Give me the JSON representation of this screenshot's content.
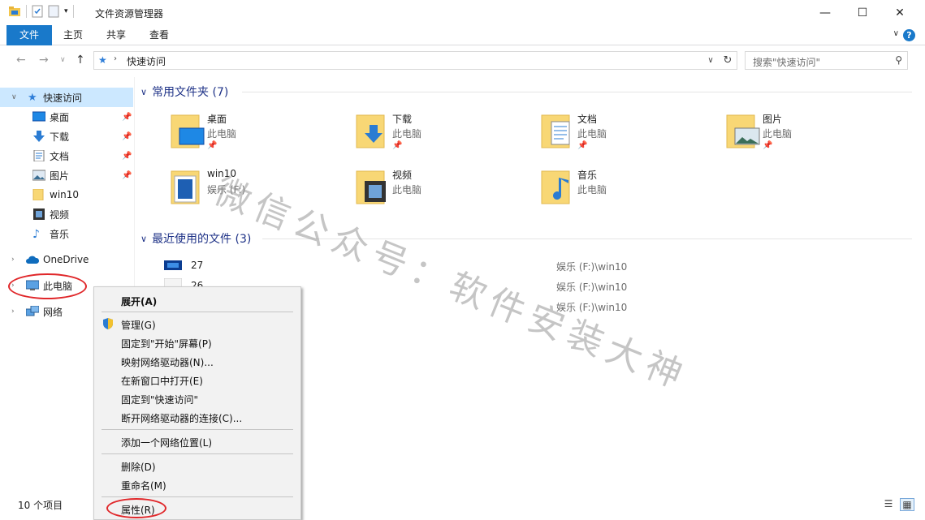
{
  "window": {
    "title": "文件资源管理器",
    "min_glyph": "—",
    "max_glyph": "☐",
    "close_glyph": "✕"
  },
  "ribbon": {
    "tabs": [
      "文件",
      "主页",
      "共享",
      "查看"
    ],
    "help": "?"
  },
  "address": {
    "path": "快速访问",
    "search_placeholder": "搜索\"快速访问\""
  },
  "nav": {
    "quick_access": "快速访问",
    "items": [
      "桌面",
      "下载",
      "文档",
      "图片",
      "win10",
      "视频",
      "音乐"
    ],
    "onedrive": "OneDrive",
    "this_pc": "此电脑",
    "network": "网络"
  },
  "groups": {
    "frequent": "常用文件夹 (7)",
    "recent": "最近使用的文件 (3)"
  },
  "folders": [
    {
      "name": "桌面",
      "location": "此电脑",
      "pinned": true
    },
    {
      "name": "下载",
      "location": "此电脑",
      "pinned": true
    },
    {
      "name": "文档",
      "location": "此电脑",
      "pinned": true
    },
    {
      "name": "图片",
      "location": "此电脑",
      "pinned": true
    },
    {
      "name": "win10",
      "location": "娱乐 (F:)",
      "pinned": false
    },
    {
      "name": "视频",
      "location": "此电脑",
      "pinned": false
    },
    {
      "name": "音乐",
      "location": "此电脑",
      "pinned": false
    }
  ],
  "recent_files": [
    {
      "name": "27",
      "path": "娱乐 (F:)\\win10"
    },
    {
      "name": "26",
      "path": "娱乐 (F:)\\win10"
    },
    {
      "name": "",
      "path": "娱乐 (F:)\\win10"
    }
  ],
  "status": {
    "count": "10 个项目"
  },
  "context_menu": {
    "items": [
      "展开(A)",
      "管理(G)",
      "固定到\"开始\"屏幕(P)",
      "映射网络驱动器(N)...",
      "在新窗口中打开(E)",
      "固定到\"快速访问\"",
      "断开网络驱动器的连接(C)...",
      "添加一个网络位置(L)",
      "删除(D)",
      "重命名(M)",
      "属性(R)"
    ]
  },
  "watermark": "微信公众号：软件安装大神",
  "colors": {
    "accent": "#1979ca",
    "selection": "#cce8ff",
    "annotation": "#e0272a",
    "group_header": "#1e3287"
  }
}
